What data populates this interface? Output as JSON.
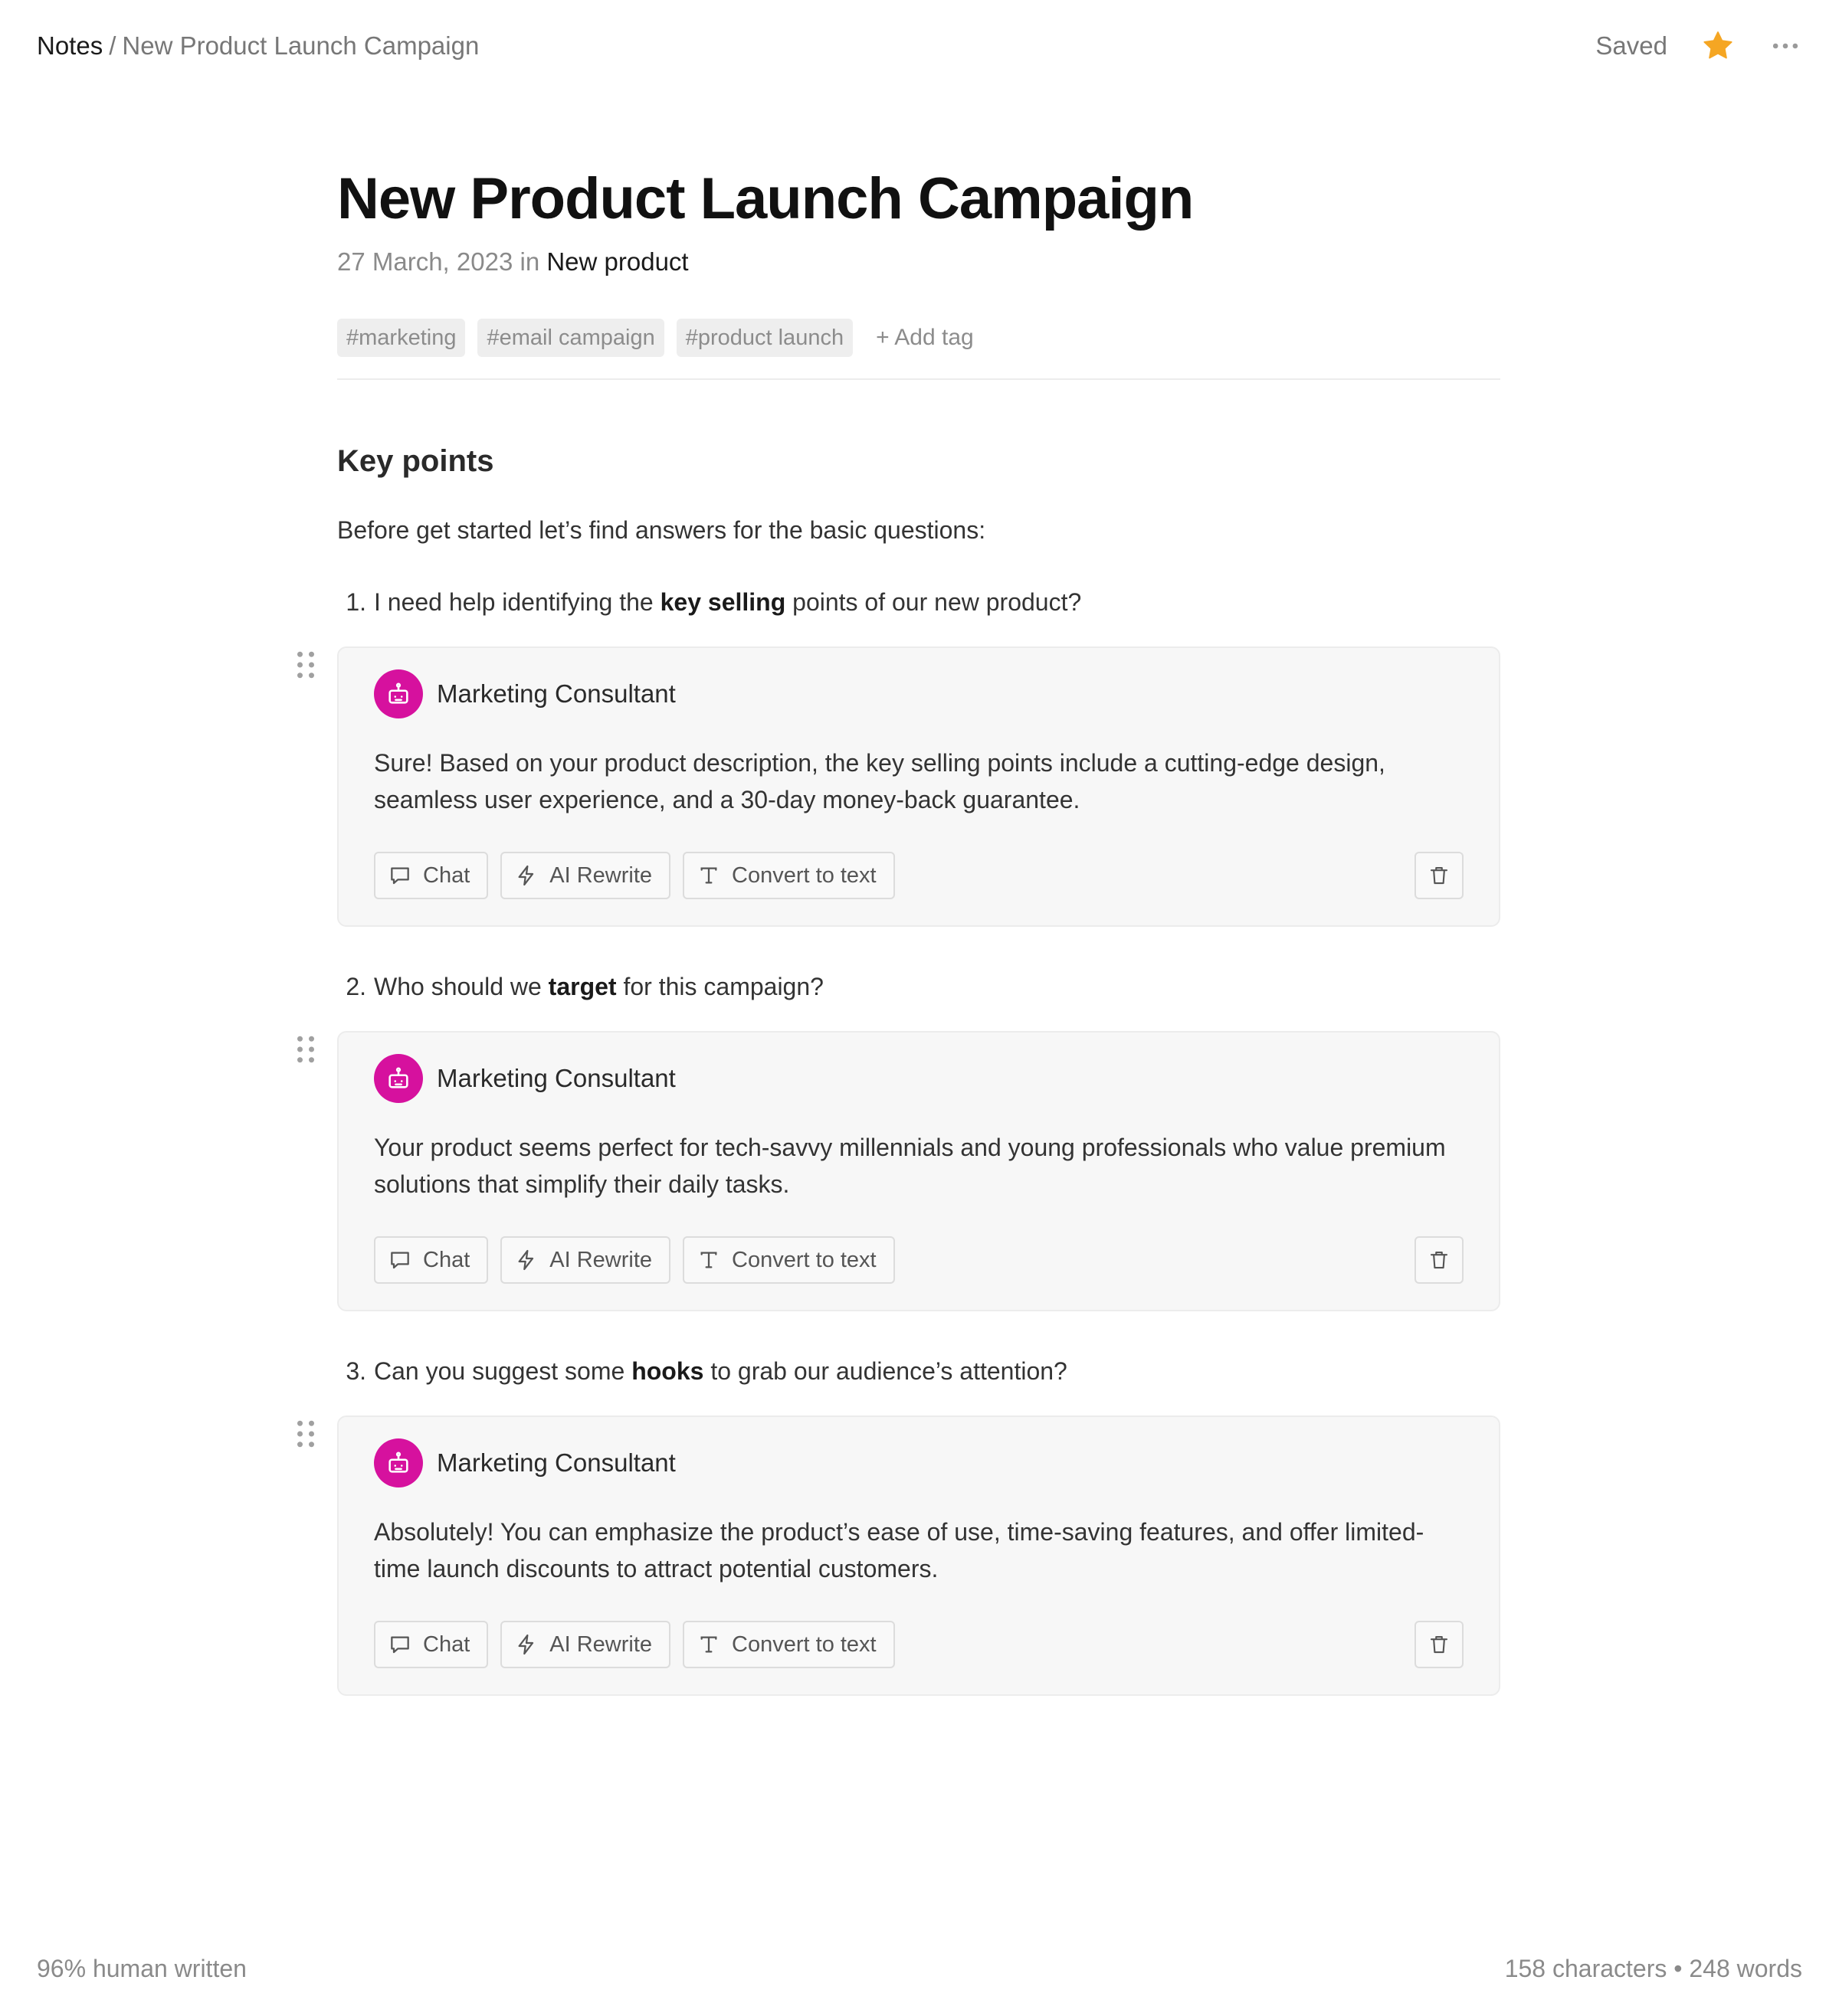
{
  "breadcrumb": {
    "root": "Notes",
    "separator": "/",
    "current": "New Product Launch Campaign"
  },
  "topbar": {
    "status": "Saved",
    "star_color": "#f5a623",
    "icons": [
      "star-icon",
      "more-options-icon"
    ]
  },
  "doc": {
    "title": "New Product Launch Campaign",
    "date": "27 March, 2023",
    "in_word": "in",
    "folder": "New product",
    "tags": [
      "#marketing",
      "#email campaign",
      "#product launch"
    ],
    "add_tag": "+ Add tag",
    "section_heading": "Key points",
    "intro": "Before get started let’s find answers for the basic questions:"
  },
  "questions": [
    {
      "number": "1.",
      "before": "I need help identifying the ",
      "bold": "key selling",
      "after": " points of our new product?",
      "response": {
        "author": "Marketing Consultant",
        "text": "Sure! Based on your product description, the key selling points include a cutting-edge design, seamless user experience, and a 30-day money-back guarantee."
      }
    },
    {
      "number": "2.",
      "before": "Who should we ",
      "bold": "target",
      "after": " for this campaign?",
      "response": {
        "author": "Marketing Consultant",
        "text": "Your product seems perfect for tech-savvy millennials and young professionals who value premium solutions that simplify their daily tasks."
      }
    },
    {
      "number": "3.",
      "before": "Can you suggest some ",
      "bold": "hooks",
      "after": " to grab our audience’s attention?",
      "response": {
        "author": "Marketing Consultant",
        "text": "Absolutely! You can emphasize the product’s ease of use, time-saving features, and offer limited-time launch discounts to attract potential customers."
      }
    }
  ],
  "card_actions": {
    "chat": "Chat",
    "rewrite": "AI Rewrite",
    "convert": "Convert to text"
  },
  "avatar_color": "#d6119e",
  "footer": {
    "human_written": "96% human written",
    "stats": "158 characters • 248 words"
  }
}
